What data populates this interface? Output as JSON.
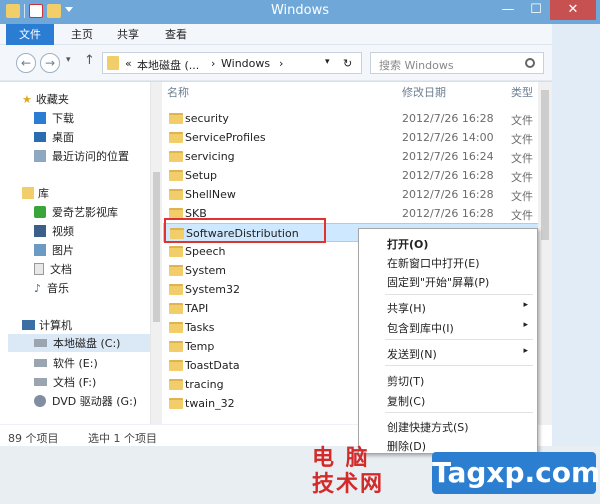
{
  "window": {
    "title": "Windows",
    "controls": {
      "minimize": "—",
      "maximize": "☐",
      "close": "✕"
    }
  },
  "ribbon": {
    "tabs": [
      {
        "label": "文件"
      },
      {
        "label": "主页"
      },
      {
        "label": "共享"
      },
      {
        "label": "查看"
      }
    ]
  },
  "navbar": {
    "back": "←",
    "forward": "→",
    "dropdown": "▾",
    "up": "↑",
    "address": {
      "prefix": "«",
      "part1": "本地磁盘 (...",
      "sep": "›",
      "part2": "Windows",
      "dropdown": "▾"
    },
    "refresh": "↻",
    "search_placeholder": "搜索 Windows"
  },
  "nav_pane": {
    "items": [
      {
        "label": "收藏夹",
        "icon": "star-icon"
      },
      {
        "label": "下载",
        "icon": "download-icon"
      },
      {
        "label": "桌面",
        "icon": "desktop-icon"
      },
      {
        "label": "最近访问的位置",
        "icon": "recent-icon"
      },
      {
        "label": "库",
        "icon": "library-icon"
      },
      {
        "label": "爱奇艺影视库",
        "icon": "iqiyi-icon"
      },
      {
        "label": "视频",
        "icon": "video-icon"
      },
      {
        "label": "图片",
        "icon": "picture-icon"
      },
      {
        "label": "文档",
        "icon": "document-icon"
      },
      {
        "label": "音乐",
        "icon": "music-icon"
      },
      {
        "label": "计算机",
        "icon": "computer-icon"
      },
      {
        "label": "本地磁盘 (C:)",
        "icon": "drive-icon"
      },
      {
        "label": "软件 (E:)",
        "icon": "drive-icon"
      },
      {
        "label": "文档 (F:)",
        "icon": "drive-icon"
      },
      {
        "label": "DVD 驱动器 (G:)",
        "icon": "dvd-icon"
      }
    ]
  },
  "files": {
    "columns": {
      "name": "名称",
      "date": "修改日期",
      "type": "类型"
    },
    "rows": [
      {
        "name": "security",
        "date": "2012/7/26 16:28",
        "type": "文件"
      },
      {
        "name": "ServiceProfiles",
        "date": "2012/7/26 14:00",
        "type": "文件"
      },
      {
        "name": "servicing",
        "date": "2012/7/26 16:24",
        "type": "文件"
      },
      {
        "name": "Setup",
        "date": "2012/7/26 16:28",
        "type": "文件"
      },
      {
        "name": "ShellNew",
        "date": "2012/7/26 16:28",
        "type": "文件"
      },
      {
        "name": "SKB",
        "date": "2012/7/26 16:28",
        "type": "文件"
      },
      {
        "name": "SoftwareDistribution",
        "date": "",
        "type": ""
      },
      {
        "name": "Speech",
        "date": "",
        "type": ""
      },
      {
        "name": "System",
        "date": "",
        "type": ""
      },
      {
        "name": "System32",
        "date": "",
        "type": ""
      },
      {
        "name": "TAPI",
        "date": "",
        "type": ""
      },
      {
        "name": "Tasks",
        "date": "",
        "type": ""
      },
      {
        "name": "Temp",
        "date": "",
        "type": ""
      },
      {
        "name": "ToastData",
        "date": "",
        "type": ""
      },
      {
        "name": "tracing",
        "date": "",
        "type": ""
      },
      {
        "name": "twain_32",
        "date": "",
        "type": ""
      }
    ]
  },
  "status": {
    "count": "89 个项目",
    "selected": "选中 1 个项目"
  },
  "context_menu": {
    "items": [
      {
        "label": "打开(O)"
      },
      {
        "label": "在新窗口中打开(E)"
      },
      {
        "label": "固定到\"开始\"屏幕(P)"
      },
      {
        "label": "共享(H)"
      },
      {
        "label": "包含到库中(I)"
      },
      {
        "label": "发送到(N)"
      },
      {
        "label": "剪切(T)"
      },
      {
        "label": "复制(C)"
      },
      {
        "label": "创建快捷方式(S)"
      },
      {
        "label": "删除(D)"
      }
    ],
    "submenu_arrow": "▸"
  },
  "watermark": {
    "line1": "电 脑",
    "line2": "技术网",
    "site": "Tagxp.com"
  },
  "colors": {
    "accent": "#2b7cd3",
    "titlebar": "#6fa8d8",
    "selection": "#cde8ff",
    "highlight": "#e0332f"
  }
}
